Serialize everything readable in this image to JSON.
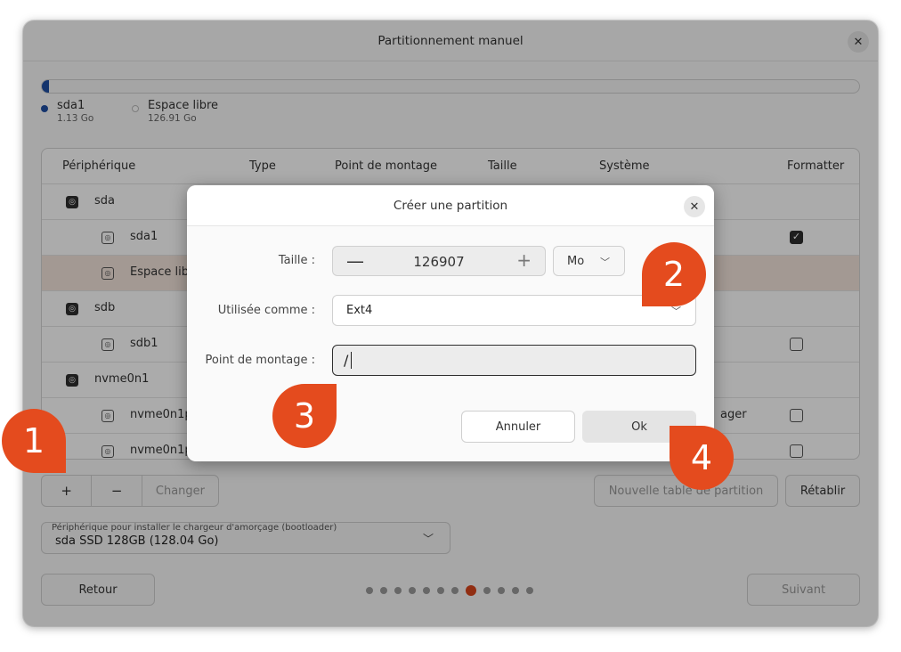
{
  "window": {
    "title": "Partitionnement manuel"
  },
  "usage": {
    "legend": [
      {
        "label": "sda1",
        "size": "1.13 Go",
        "color": "#1f4ea3"
      },
      {
        "label": "Espace libre",
        "size": "126.91 Go",
        "color": "#ffffff"
      }
    ],
    "fill_fraction": 0.009
  },
  "table": {
    "headers": [
      "Périphérique",
      "Type",
      "Point de montage",
      "Taille",
      "Système",
      "Formatter"
    ],
    "rows": [
      {
        "name": "sda",
        "kind": "disk"
      },
      {
        "name": "sda1",
        "kind": "partition",
        "formatter": true
      },
      {
        "name": "Espace libre",
        "kind": "partition",
        "selected": true
      },
      {
        "name": "sdb",
        "kind": "disk"
      },
      {
        "name": "sdb1",
        "kind": "partition",
        "formatter": false
      },
      {
        "name": "nvme0n1",
        "kind": "disk"
      },
      {
        "name": "nvme0n1p",
        "kind": "partition",
        "system_fragment": "ager",
        "formatter": false
      },
      {
        "name": "nvme0n1p",
        "kind": "partition",
        "formatter": false
      }
    ]
  },
  "toolbar": {
    "add": "+",
    "remove": "−",
    "change": "Changer",
    "new_table": "Nouvelle table de partition",
    "reset": "Rétablir"
  },
  "bootloader": {
    "caption": "Périphérique pour installer le chargeur d'amorçage (bootloader)",
    "value": "sda SSD 128GB (128.04 Go)"
  },
  "footer": {
    "back": "Retour",
    "next": "Suivant",
    "steps_total": 12,
    "step_current": 7
  },
  "dialog": {
    "title": "Créer une partition",
    "size_label": "Taille :",
    "size_value": "126907",
    "unit": "Mo",
    "used_as_label": "Utilisée comme :",
    "used_as_value": "Ext4",
    "mount_label": "Point de montage :",
    "mount_value": "/",
    "cancel": "Annuler",
    "ok": "Ok"
  },
  "annotations": [
    "1",
    "2",
    "3",
    "4"
  ],
  "colors": {
    "accent": "#e44b1e",
    "selection": "#f3e4dc"
  },
  "icons": [
    "close-icon",
    "disk-icon",
    "partition-icon",
    "checkbox-checked-icon",
    "chevron-down-icon",
    "minus-icon",
    "plus-icon"
  ]
}
